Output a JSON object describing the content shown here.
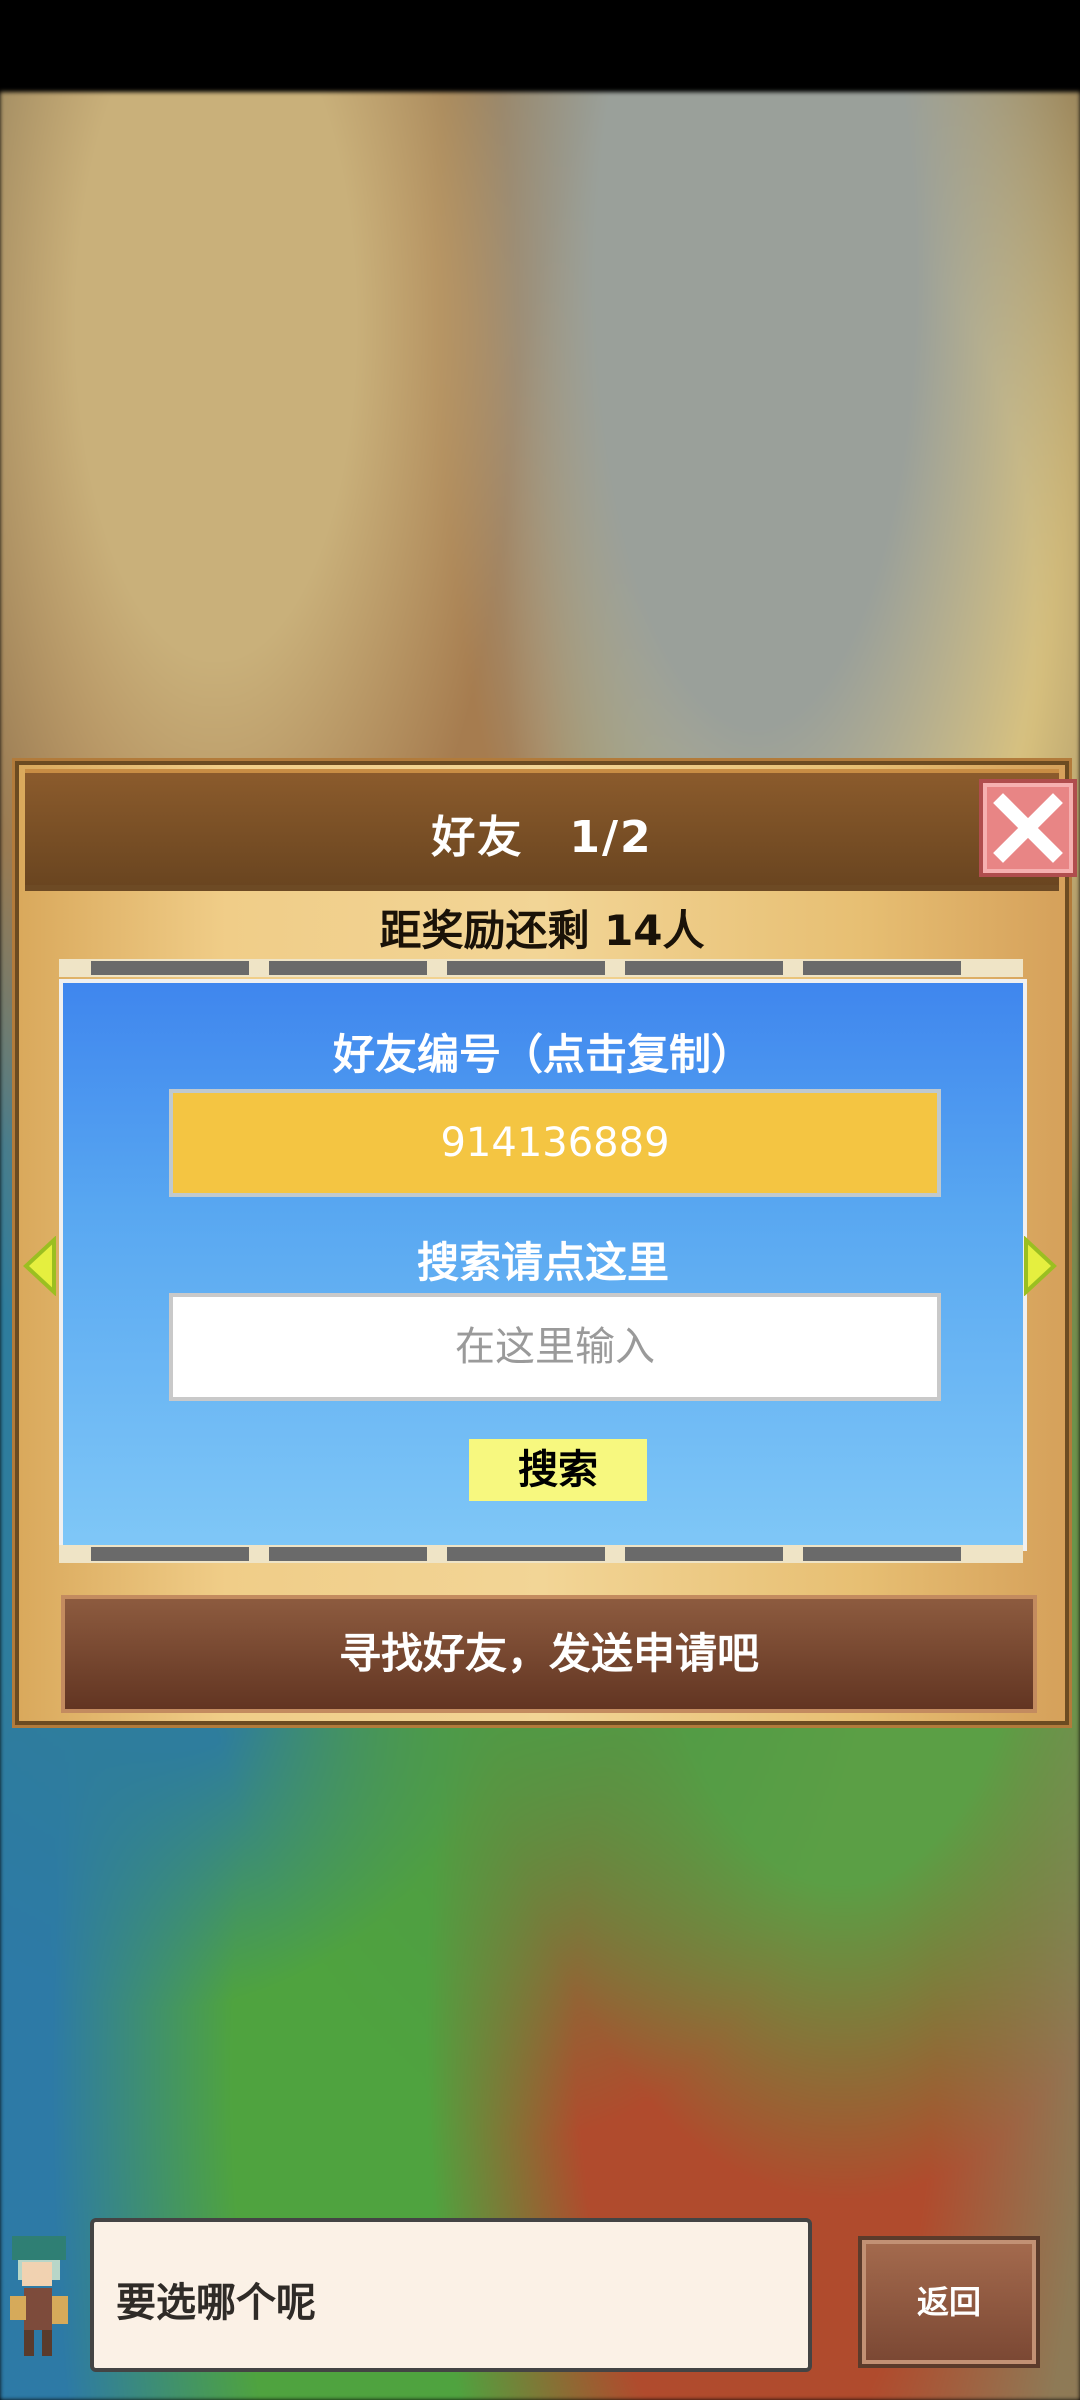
{
  "dialog": {
    "title": "好友　1/2",
    "reward_text": "距奖励还剩 14人"
  },
  "panel": {
    "friend_id_label": "好友编号（点击复制）",
    "friend_id_value": "914136889",
    "search_label": "搜索请点这里",
    "search_placeholder": "在这里输入",
    "search_button": "搜索"
  },
  "action": {
    "primary_button": "寻找好友，发送申请吧"
  },
  "footer": {
    "message": "要选哪个呢",
    "back_button": "返回"
  },
  "icons": {
    "close": "close-icon",
    "left_arrow": "chevron-left-icon",
    "right_arrow": "chevron-right-icon",
    "avatar": "avatar-icon"
  }
}
